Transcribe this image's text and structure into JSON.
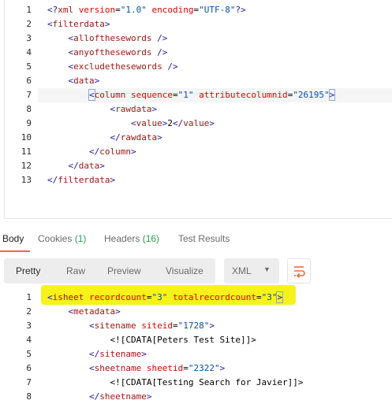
{
  "request_editor": {
    "lines": [
      {
        "n": "1",
        "parts": [
          [
            "punc",
            "<?"
          ],
          [
            "tag",
            "xml"
          ],
          [
            "txt",
            " "
          ],
          [
            "attr",
            "version"
          ],
          [
            "txt",
            "="
          ],
          [
            "val",
            "\"1.0\""
          ],
          [
            "txt",
            " "
          ],
          [
            "attr",
            "encoding"
          ],
          [
            "txt",
            "="
          ],
          [
            "val",
            "\"UTF-8\""
          ],
          [
            "punc",
            "?>"
          ]
        ]
      },
      {
        "n": "2",
        "parts": [
          [
            "punc",
            "<"
          ],
          [
            "tag",
            "filterdata"
          ],
          [
            "punc",
            ">"
          ]
        ]
      },
      {
        "n": "3",
        "parts": [
          [
            "txt",
            "    "
          ],
          [
            "punc",
            "<"
          ],
          [
            "tag",
            "allofthesewords"
          ],
          [
            "punc",
            " />"
          ]
        ]
      },
      {
        "n": "4",
        "parts": [
          [
            "txt",
            "    "
          ],
          [
            "punc",
            "<"
          ],
          [
            "tag",
            "anyofthesewords"
          ],
          [
            "punc",
            " />"
          ]
        ]
      },
      {
        "n": "5",
        "parts": [
          [
            "txt",
            "    "
          ],
          [
            "punc",
            "<"
          ],
          [
            "tag",
            "excludethesewords"
          ],
          [
            "punc",
            " />"
          ]
        ]
      },
      {
        "n": "6",
        "parts": [
          [
            "txt",
            "    "
          ],
          [
            "punc",
            "<"
          ],
          [
            "tag",
            "data"
          ],
          [
            "punc",
            ">"
          ]
        ]
      },
      {
        "n": "7",
        "parts": [
          [
            "txt",
            "        "
          ],
          [
            "punc",
            "<"
          ],
          [
            "tag",
            "column"
          ],
          [
            "txt",
            " "
          ],
          [
            "attr",
            "sequence"
          ],
          [
            "txt",
            "="
          ],
          [
            "val",
            "\"1\""
          ],
          [
            "txt",
            " "
          ],
          [
            "attr",
            "attributecolumnid"
          ],
          [
            "txt",
            "="
          ],
          [
            "val",
            "\"26195\""
          ],
          [
            "punc",
            ">"
          ]
        ]
      },
      {
        "n": "8",
        "parts": [
          [
            "txt",
            "            "
          ],
          [
            "punc",
            "<"
          ],
          [
            "tag",
            "rawdata"
          ],
          [
            "punc",
            ">"
          ]
        ]
      },
      {
        "n": "9",
        "parts": [
          [
            "txt",
            "                "
          ],
          [
            "punc",
            "<"
          ],
          [
            "tag",
            "value"
          ],
          [
            "punc",
            ">"
          ],
          [
            "txt",
            "2"
          ],
          [
            "punc",
            "</"
          ],
          [
            "tag",
            "value"
          ],
          [
            "punc",
            ">"
          ]
        ]
      },
      {
        "n": "10",
        "parts": [
          [
            "txt",
            "            "
          ],
          [
            "punc",
            "</"
          ],
          [
            "tag",
            "rawdata"
          ],
          [
            "punc",
            ">"
          ]
        ]
      },
      {
        "n": "11",
        "parts": [
          [
            "txt",
            "        "
          ],
          [
            "punc",
            "</"
          ],
          [
            "tag",
            "column"
          ],
          [
            "punc",
            ">"
          ]
        ]
      },
      {
        "n": "12",
        "parts": [
          [
            "txt",
            "    "
          ],
          [
            "punc",
            "</"
          ],
          [
            "tag",
            "data"
          ],
          [
            "punc",
            ">"
          ]
        ]
      },
      {
        "n": "13",
        "parts": [
          [
            "punc",
            "</"
          ],
          [
            "tag",
            "filterdata"
          ],
          [
            "punc",
            ">"
          ]
        ]
      }
    ]
  },
  "response_tabs": {
    "body": "Body",
    "cookies": "Cookies",
    "cookies_count": "(1)",
    "headers": "Headers",
    "headers_count": "(16)",
    "test_results": "Test Results"
  },
  "view_modes": {
    "pretty": "Pretty",
    "raw": "Raw",
    "preview": "Preview",
    "visualize": "Visualize"
  },
  "format_select": {
    "value": "XML",
    "caret": "▼"
  },
  "wrap_icon": "wrap-lines-icon",
  "accent_color": "#f26b3a",
  "highlight_color": "#f6f21a",
  "response_body": {
    "lines": [
      {
        "n": "1",
        "parts": [
          [
            "punc",
            "<"
          ],
          [
            "tag",
            "isheet"
          ],
          [
            "txt",
            " "
          ],
          [
            "attr",
            "recordcount"
          ],
          [
            "txt",
            "="
          ],
          [
            "val",
            "\"3\""
          ],
          [
            "txt",
            " "
          ],
          [
            "attr",
            "totalrecordcount"
          ],
          [
            "txt",
            "="
          ],
          [
            "val",
            "\"3\""
          ],
          [
            "punc",
            ">"
          ]
        ]
      },
      {
        "n": "2",
        "parts": [
          [
            "txt",
            "    "
          ],
          [
            "punc",
            "<"
          ],
          [
            "tag",
            "metadata"
          ],
          [
            "punc",
            ">"
          ]
        ]
      },
      {
        "n": "3",
        "parts": [
          [
            "txt",
            "        "
          ],
          [
            "punc",
            "<"
          ],
          [
            "tag",
            "sitename"
          ],
          [
            "txt",
            " "
          ],
          [
            "attr",
            "siteid"
          ],
          [
            "txt",
            "="
          ],
          [
            "val",
            "\"1728\""
          ],
          [
            "punc",
            ">"
          ]
        ]
      },
      {
        "n": "4",
        "parts": [
          [
            "txt",
            "            "
          ],
          [
            "txt",
            "<![CDATA[Peters Test Site]]>"
          ]
        ]
      },
      {
        "n": "5",
        "parts": [
          [
            "txt",
            "        "
          ],
          [
            "punc",
            "</"
          ],
          [
            "tag",
            "sitename"
          ],
          [
            "punc",
            ">"
          ]
        ]
      },
      {
        "n": "6",
        "parts": [
          [
            "txt",
            "        "
          ],
          [
            "punc",
            "<"
          ],
          [
            "tag",
            "sheetname"
          ],
          [
            "txt",
            " "
          ],
          [
            "attr",
            "sheetid"
          ],
          [
            "txt",
            "="
          ],
          [
            "val",
            "\"2322\""
          ],
          [
            "punc",
            ">"
          ]
        ]
      },
      {
        "n": "7",
        "parts": [
          [
            "txt",
            "            "
          ],
          [
            "txt",
            "<![CDATA[Testing Search for Javier]]>"
          ]
        ]
      },
      {
        "n": "8",
        "parts": [
          [
            "txt",
            "        "
          ],
          [
            "punc",
            "</"
          ],
          [
            "tag",
            "sheetname"
          ],
          [
            "punc",
            ">"
          ]
        ]
      }
    ]
  }
}
